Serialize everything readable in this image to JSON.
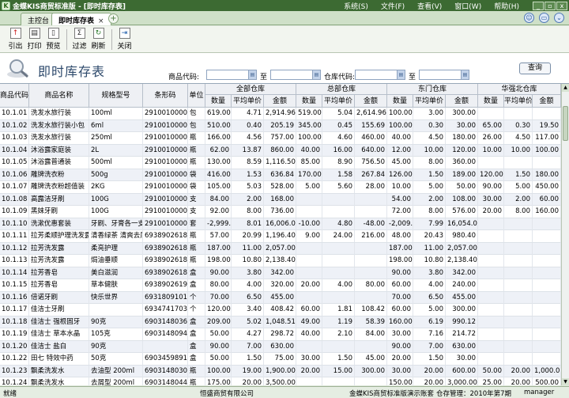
{
  "app_title": "金蝶KIS商贸标准版 - [即时库存表]",
  "menu": [
    "系统(S)",
    "文件(F)",
    "查看(V)",
    "窗口(W)",
    "帮助(H)"
  ],
  "window_buttons": [
    "_",
    "▫",
    "x"
  ],
  "tabs": [
    {
      "label": "主控台",
      "active": false
    },
    {
      "label": "即时库存表",
      "active": true,
      "close": "×"
    }
  ],
  "toolbar": [
    {
      "label": "引出",
      "icon": "export-icon"
    },
    {
      "label": "打印",
      "icon": "print-icon"
    },
    {
      "label": "预览",
      "icon": "preview-icon"
    },
    {
      "label": "过滤",
      "icon": "filter-icon"
    },
    {
      "label": "刷新",
      "icon": "refresh-icon"
    },
    {
      "label": "关闭",
      "icon": "close-door-icon"
    }
  ],
  "page_title": "即时库存表",
  "filters": {
    "product_code_label": "商品代码:",
    "to_label_1": "至",
    "warehouse_code_label": "仓库代码:",
    "to_label_2": "至",
    "query_button": "查询"
  },
  "columns": {
    "code": "商品代码",
    "name": "商品名称",
    "spec": "规格型号",
    "barcode": "条形码",
    "unit": "单位",
    "groups": [
      "全部仓库",
      "总部仓库",
      "东门仓库",
      "华强北仓库"
    ],
    "sub": [
      "数量",
      "平均单价",
      "金额"
    ]
  },
  "rows": [
    [
      "10.1.01",
      "洗发水旅行装",
      "100ml",
      "2910010000014",
      "包",
      "619.00",
      "4.71",
      "2,914.96",
      "519.00",
      "5.04",
      "2,614.96",
      "100.00",
      "3.00",
      "300.00",
      "",
      "",
      ""
    ],
    [
      "10.1.02",
      "洗发水旅行装小包",
      "6ml",
      "2910010000021",
      "包",
      "510.00",
      "0.40",
      "205.19",
      "345.00",
      "0.45",
      "155.69",
      "100.00",
      "0.30",
      "30.00",
      "65.00",
      "0.30",
      "19.50"
    ],
    [
      "10.1.03",
      "洗发水旅行装",
      "250ml",
      "2910010000038",
      "瓶",
      "166.00",
      "4.56",
      "757.00",
      "100.00",
      "4.60",
      "460.00",
      "40.00",
      "4.50",
      "180.00",
      "26.00",
      "4.50",
      "117.00"
    ],
    [
      "10.1.04",
      "沐浴露家庭装",
      "2L",
      "2910010000045",
      "瓶",
      "62.00",
      "13.87",
      "860.00",
      "40.00",
      "16.00",
      "640.00",
      "12.00",
      "10.00",
      "120.00",
      "10.00",
      "10.00",
      "100.00"
    ],
    [
      "10.1.05",
      "沐浴露普通装",
      "500ml",
      "2910010000052",
      "瓶",
      "130.00",
      "8.59",
      "1,116.50",
      "85.00",
      "8.90",
      "756.50",
      "45.00",
      "8.00",
      "360.00",
      "",
      "",
      ""
    ],
    [
      "10.1.06",
      "雕牌洗衣粉",
      "500g",
      "2910010000076",
      "袋",
      "416.00",
      "1.53",
      "636.84",
      "170.00",
      "1.58",
      "267.84",
      "126.00",
      "1.50",
      "189.00",
      "120.00",
      "1.50",
      "180.00"
    ],
    [
      "10.1.07",
      "雕牌洗衣粉超值装",
      "2KG",
      "2910010000069",
      "袋",
      "105.00",
      "5.03",
      "528.00",
      "5.00",
      "5.60",
      "28.00",
      "10.00",
      "5.00",
      "50.00",
      "90.00",
      "5.00",
      "450.00"
    ],
    [
      "10.1.08",
      "高露洁牙刷",
      "100G",
      "2910010000083",
      "支",
      "84.00",
      "2.00",
      "168.00",
      "",
      "",
      "",
      "54.00",
      "2.00",
      "108.00",
      "30.00",
      "2.00",
      "60.00"
    ],
    [
      "10.1.09",
      "黑妹牙刷",
      "100G",
      "2910010000090",
      "支",
      "92.00",
      "8.00",
      "736.00",
      "",
      "",
      "",
      "72.00",
      "8.00",
      "576.00",
      "20.00",
      "8.00",
      "160.00"
    ],
    [
      "10.1.10",
      "洗漱优惠套装",
      "牙刷、牙膏各一支",
      "2910010000106",
      "套",
      "-2,999.00",
      "8.01",
      "16,006.00",
      "-10.00",
      "4.80",
      "-48.00",
      "-2,009.00",
      "7.99",
      "16,054.00",
      "",
      "",
      ""
    ],
    [
      "10.1.11",
      "拉芳柔顺护理洗发露",
      "清香绿茶 清爽去屑",
      "6938902618358",
      "瓶",
      "57.00",
      "20.99",
      "1,196.40",
      "9.00",
      "24.00",
      "216.00",
      "48.00",
      "20.43",
      "980.40",
      "",
      "",
      ""
    ],
    [
      "10.1.12",
      "拉芳洗发露",
      "柔亮护理",
      "6938902618020",
      "瓶",
      "187.00",
      "11.00",
      "2,057.00",
      "",
      "",
      "",
      "187.00",
      "11.00",
      "2,057.00",
      "",
      "",
      ""
    ],
    [
      "10.1.13",
      "拉芳洗发露",
      "焗油垂顺",
      "6938902618037",
      "瓶",
      "198.00",
      "10.80",
      "2,138.40",
      "",
      "",
      "",
      "198.00",
      "10.80",
      "2,138.40",
      "",
      "",
      ""
    ],
    [
      "10.1.14",
      "拉芳香皂",
      "美白滋润",
      "6938902618983",
      "盒",
      "90.00",
      "3.80",
      "342.00",
      "",
      "",
      "",
      "90.00",
      "3.80",
      "342.00",
      "",
      "",
      ""
    ],
    [
      "10.1.15",
      "拉芳香皂",
      "草本健肤",
      "6938902619157",
      "盒",
      "80.00",
      "4.00",
      "320.00",
      "20.00",
      "4.00",
      "80.00",
      "60.00",
      "4.00",
      "240.00",
      "",
      "",
      ""
    ],
    [
      "10.1.16",
      "倍诺牙刷",
      "快乐世界",
      "6931809101367",
      "个",
      "70.00",
      "6.50",
      "455.00",
      "",
      "",
      "",
      "70.00",
      "6.50",
      "455.00",
      "",
      "",
      ""
    ],
    [
      "10.1.17",
      "佳洁士牙刷",
      "",
      "6934741703354",
      "个",
      "120.00",
      "3.40",
      "408.42",
      "60.00",
      "1.81",
      "108.42",
      "60.00",
      "5.00",
      "300.00",
      "",
      "",
      ""
    ],
    [
      "10.1.18",
      "佳洁士 强根固牙",
      "90克",
      "6903148036143",
      "盒",
      "209.00",
      "5.02",
      "1,048.51",
      "49.00",
      "1.19",
      "58.39",
      "160.00",
      "6.19",
      "990.12",
      "",
      "",
      ""
    ],
    [
      "10.1.19",
      "佳洁士 草本水晶",
      "105克",
      "6903148094822",
      "盒",
      "50.00",
      "4.27",
      "298.72",
      "40.00",
      "2.10",
      "84.00",
      "30.00",
      "7.16",
      "214.72",
      "",
      "",
      ""
    ],
    [
      "10.1.20",
      "佳洁士 盐白",
      "90克",
      "",
      "盒",
      "90.00",
      "7.00",
      "630.00",
      "",
      "",
      "",
      "90.00",
      "7.00",
      "630.00",
      "",
      "",
      ""
    ],
    [
      "10.1.22",
      "田七 特效中药",
      "50克",
      "6903459891655",
      "盒",
      "50.00",
      "1.50",
      "75.00",
      "30.00",
      "1.50",
      "45.00",
      "20.00",
      "1.50",
      "30.00",
      "",
      "",
      ""
    ],
    [
      "10.1.23",
      "飘柔洗发水",
      "去油型 200ml",
      "6903148030462",
      "瓶",
      "100.00",
      "19.00",
      "1,900.00",
      "20.00",
      "15.00",
      "300.00",
      "30.00",
      "20.00",
      "600.00",
      "50.00",
      "20.00",
      "1,000.00"
    ],
    [
      "10.1.24",
      "飘柔洗发水",
      "去屑型 200ml",
      "6903148044933",
      "瓶",
      "175.00",
      "20.00",
      "3,500.00",
      "",
      "",
      "",
      "150.00",
      "20.00",
      "3,000.00",
      "25.00",
      "20.00",
      "500.00"
    ],
    [
      "10.1.25",
      "飘柔洗发水",
      "滋养型 200ml",
      "6903148044919",
      "瓶",
      "105.00",
      "20.00",
      "2,100.00",
      "",
      "",
      "",
      "5.00",
      "20.00",
      "100.00",
      "100.00",
      "20.00",
      "2,000.00"
    ]
  ],
  "status": {
    "left": "就绪",
    "company": "恒盛商贸有限公司",
    "app": "金蝶KIS商贸标准版演示账套",
    "period": "仓存管理：2010年第7期",
    "user": "manager"
  }
}
